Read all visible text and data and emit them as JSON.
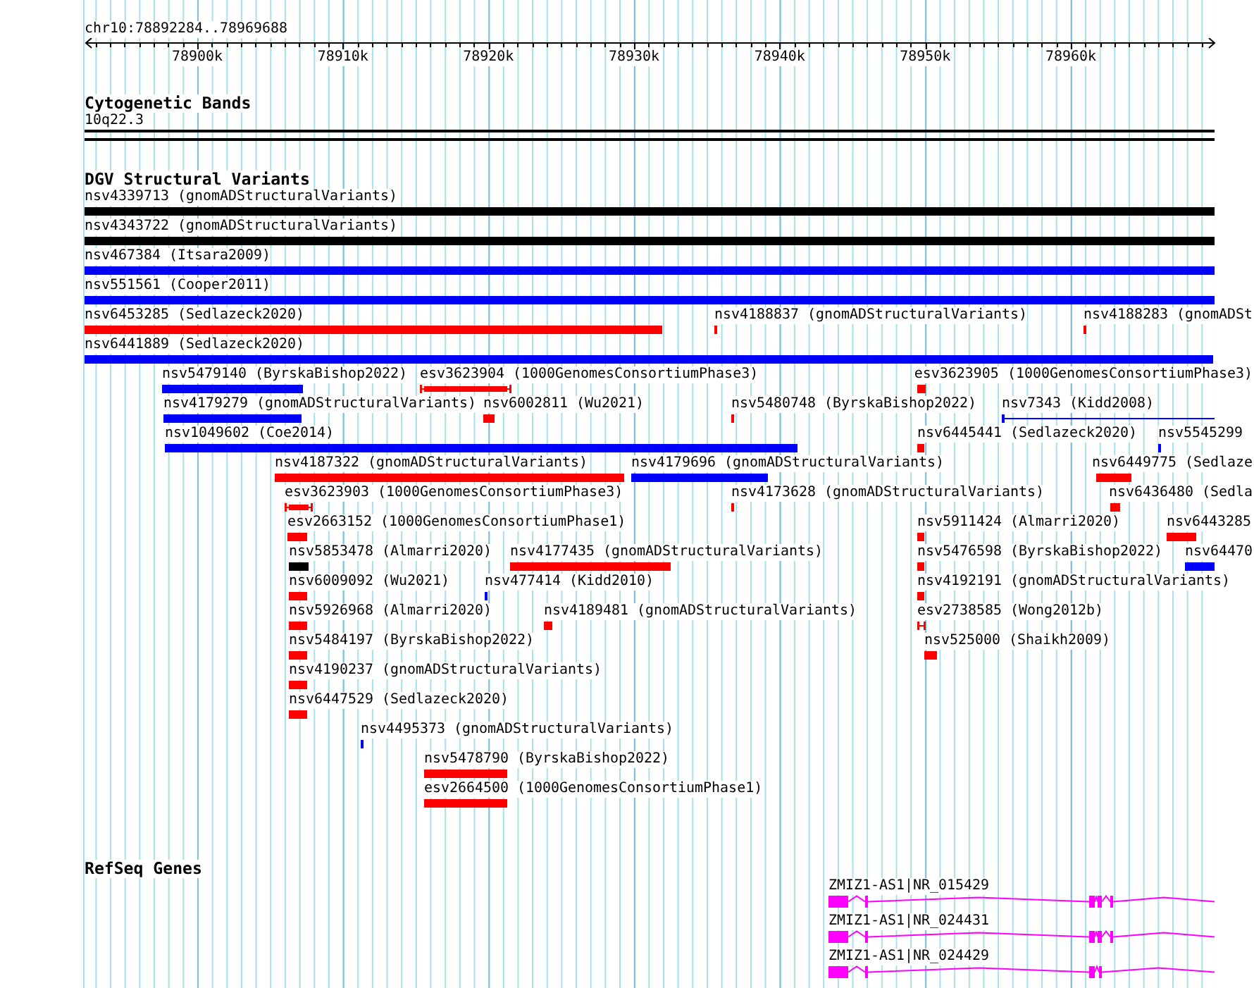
{
  "ruler": {
    "location": "chr10:78892284..78969688",
    "ticks": [
      "78900k",
      "78910k",
      "78920k",
      "78930k",
      "78940k",
      "78950k",
      "78960k"
    ]
  },
  "tracks": [
    {
      "kind": "bands",
      "title": "Cytogenetic Bands",
      "items": [
        {
          "label": "10q22.3"
        }
      ]
    },
    {
      "kind": "variants",
      "title": "DGV Structural Variants",
      "items": [
        {
          "label": "nsv4339713 (gnomADStructuralVariants)",
          "color": "#000000",
          "kind": "bar"
        },
        {
          "label": "nsv4343722 (gnomADStructuralVariants)",
          "color": "#000000",
          "kind": "bar"
        },
        {
          "label": "nsv467384 (Itsara2009)",
          "color": "#0000ff",
          "kind": "bar"
        },
        {
          "label": "nsv551561 (Cooper2011)",
          "color": "#0000ff",
          "kind": "bar"
        },
        {
          "label": "nsv6453285 (Sedlazeck2020)",
          "color": "#ff0000",
          "kind": "bar"
        },
        {
          "label": "nsv4188837 (gnomADStructuralVariants)",
          "color": "#ff0000",
          "kind": "bar"
        },
        {
          "label": "nsv4188283 (gnomADSt",
          "color": "#ff0000",
          "kind": "bar"
        },
        {
          "label": "nsv6441889 (Sedlazeck2020)",
          "color": "#0000ff",
          "kind": "bar"
        },
        {
          "label": "nsv5479140 (ByrskaBishop2022)",
          "color": "#0000ff",
          "kind": "bar"
        },
        {
          "label": "esv3623904 (1000GenomesConsortiumPhase3)",
          "color": "#ff0000",
          "kind": "interval"
        },
        {
          "label": "esv3623905 (1000GenomesConsortiumPhase3)",
          "color": "#ff0000",
          "kind": "bar"
        },
        {
          "label": "nsv4179279 (gnomADStructuralVariants)",
          "color": "#0000ff",
          "kind": "bar"
        },
        {
          "label": "nsv6002811 (Wu2021)",
          "color": "#ff0000",
          "kind": "bar"
        },
        {
          "label": "nsv5480748 (ByrskaBishop2022)",
          "color": "#ff0000",
          "kind": "bar"
        },
        {
          "label": "nsv7343 (Kidd2008)",
          "color": "#0000ff",
          "kind": "line"
        },
        {
          "label": "nsv1049602 (Coe2014)",
          "color": "#0000ff",
          "kind": "bar"
        },
        {
          "label": "nsv6445441 (Sedlazeck2020)",
          "color": "#ff0000",
          "kind": "bar"
        },
        {
          "label": "nsv5545299",
          "color": "#0000ff",
          "kind": "bar"
        },
        {
          "label": "nsv4187322 (gnomADStructuralVariants)",
          "color": "#ff0000",
          "kind": "bar"
        },
        {
          "label": "nsv4179696 (gnomADStructuralVariants)",
          "color": "#0000ff",
          "kind": "bar"
        },
        {
          "label": "nsv6449775 (Sedlaze",
          "color": "#ff0000",
          "kind": "bar"
        },
        {
          "label": "esv3623903 (1000GenomesConsortiumPhase3)",
          "color": "#ff0000",
          "kind": "interval"
        },
        {
          "label": "nsv4173628 (gnomADStructuralVariants)",
          "color": "#ff0000",
          "kind": "bar"
        },
        {
          "label": "nsv6436480 (Sedla",
          "color": "#ff0000",
          "kind": "bar"
        },
        {
          "label": "esv2663152 (1000GenomesConsortiumPhase1)",
          "color": "#ff0000",
          "kind": "bar"
        },
        {
          "label": "nsv5911424 (Almarri2020)",
          "color": "#ff0000",
          "kind": "bar"
        },
        {
          "label": "nsv6443285",
          "color": "#ff0000",
          "kind": "bar"
        },
        {
          "label": "nsv5853478 (Almarri2020)",
          "color": "#000000",
          "kind": "bar"
        },
        {
          "label": "nsv4177435 (gnomADStructuralVariants)",
          "color": "#ff0000",
          "kind": "bar"
        },
        {
          "label": "nsv5476598 (ByrskaBishop2022)",
          "color": "#ff0000",
          "kind": "bar"
        },
        {
          "label": "nsv64470",
          "color": "#0000ff",
          "kind": "bar"
        },
        {
          "label": "nsv6009092 (Wu2021)",
          "color": "#ff0000",
          "kind": "bar"
        },
        {
          "label": "nsv477414 (Kidd2010)",
          "color": "#0000ff",
          "kind": "bar"
        },
        {
          "label": "nsv4192191 (gnomADStructuralVariants)",
          "color": "#ff0000",
          "kind": "bar"
        },
        {
          "label": "nsv5926968 (Almarri2020)",
          "color": "#ff0000",
          "kind": "bar"
        },
        {
          "label": "nsv4189481 (gnomADStructuralVariants)",
          "color": "#ff0000",
          "kind": "bar"
        },
        {
          "label": "esv2738585 (Wong2012b)",
          "color": "#ff0000",
          "kind": "interval"
        },
        {
          "label": "nsv5484197 (ByrskaBishop2022)",
          "color": "#ff0000",
          "kind": "bar"
        },
        {
          "label": "nsv525000 (Shaikh2009)",
          "color": "#ff0000",
          "kind": "bar"
        },
        {
          "label": "nsv4190237 (gnomADStructuralVariants)",
          "color": "#ff0000",
          "kind": "bar"
        },
        {
          "label": "nsv6447529 (Sedlazeck2020)",
          "color": "#ff0000",
          "kind": "bar"
        },
        {
          "label": "nsv4495373 (gnomADStructuralVariants)",
          "color": "#0000ff",
          "kind": "bar"
        },
        {
          "label": "nsv5478790 (ByrskaBishop2022)",
          "color": "#ff0000",
          "kind": "bar"
        },
        {
          "label": "esv2664500 (1000GenomesConsortiumPhase1)",
          "color": "#ff0000",
          "kind": "bar"
        }
      ]
    },
    {
      "kind": "genes",
      "title": "RefSeq Genes",
      "items": [
        {
          "label": "ZMIZ1-AS1|NR_015429"
        },
        {
          "label": "ZMIZ1-AS1|NR_024431"
        },
        {
          "label": "ZMIZ1-AS1|NR_024429"
        }
      ]
    }
  ]
}
